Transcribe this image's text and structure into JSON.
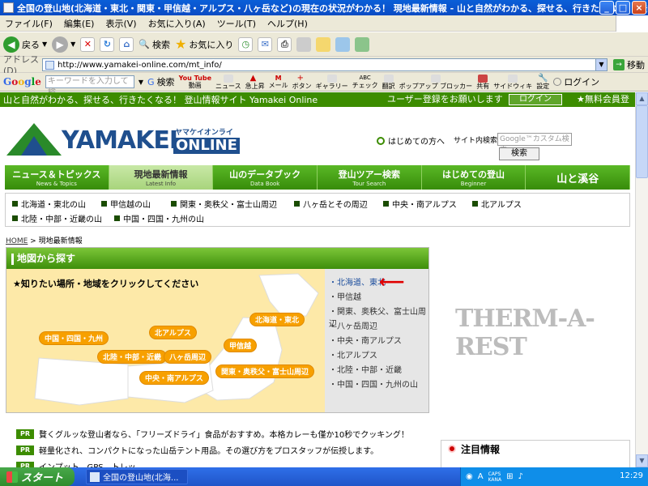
{
  "window": {
    "title": "全国の登山地(北海道・東北・関東・甲信越・アルプス・八ヶ岳など)の現在の状況がわかる！ 現地最新情報 - 山と自然がわかる、探せる、行きたくなる！ 登山情..."
  },
  "menu": [
    "ファイル(F)",
    "編集(E)",
    "表示(V)",
    "お気に入り(A)",
    "ツール(T)",
    "ヘルプ(H)"
  ],
  "toolbar": {
    "back": "戻る",
    "search": "検索",
    "favorites": "お気に入り"
  },
  "address": {
    "label": "アドレス(D)",
    "url": "http://www.yamakei-online.com/mt_info/",
    "go": "移動"
  },
  "google": {
    "logo": "Google",
    "placeholder": "キーワードを入力して検",
    "search_btn": "検索",
    "login": "ログイン",
    "tools": [
      "動画",
      "ニュース",
      "急上昇",
      "メール",
      "ボタン",
      "ギャラリー",
      "チェック",
      "翻訳",
      "ポップアップ ブロッカー",
      "共有",
      "サイドウィキ",
      "設定"
    ],
    "tool_tops": [
      "You Tube",
      "",
      "",
      "M",
      "",
      "",
      "ABC",
      "",
      "",
      "",
      "",
      ""
    ]
  },
  "site": {
    "tagline": "山と自然がわかる、探せる、行きたくなる！ 登山情報サイト Yamakei Online",
    "register": "ユーザー登録をお願いします",
    "login": "ログイン",
    "free": "★無料会員登録",
    "logo_main": "YAMAKEI",
    "logo_kana": "ヤマケイオンライン",
    "logo_online": "ONLINE",
    "first_time": "はじめての方へ",
    "site_search_label": "サイト内検索",
    "site_search_placeholder": "Google™カスタム検索",
    "site_search_btn": "検索"
  },
  "gnav": [
    {
      "label": "ニュース＆トピックス",
      "sub": "News & Topics"
    },
    {
      "label": "現地最新情報",
      "sub": "Latest Info"
    },
    {
      "label": "山のデータブック",
      "sub": "Data Book"
    },
    {
      "label": "登山ツアー検索",
      "sub": "Tour Search"
    },
    {
      "label": "はじめての登山",
      "sub": "Beginner"
    },
    {
      "label": "山と溪谷",
      "sub": ""
    }
  ],
  "areas": [
    "北海道・東北の山",
    "甲信越の山",
    "関東・奥秩父・富士山周辺",
    "八ヶ岳とその周辺",
    "中央・南アルプス",
    "北アルプス",
    "北陸・中部・近畿の山",
    "中国・四国・九州の山"
  ],
  "breadcrumb": {
    "home": "HOME",
    "current": "現地最新情報"
  },
  "map": {
    "header": "地図から探す",
    "prompt": "★知りたい場所・地域をクリックしてください",
    "pills": [
      "北海道・東北",
      "北アルプス",
      "甲信越",
      "中国・四国・九州",
      "北陸・中部・近畿",
      "八ヶ岳周辺",
      "中央・南アルプス",
      "関東・奥秩父・富士山周辺"
    ],
    "list": [
      "・北海道、東北",
      "・甲信越",
      "・関東、奥秩父、富士山周辺",
      "・八ヶ岳周辺",
      "・中央・南アルプス",
      "・北アルプス",
      "・北陸・中部・近畿",
      "・中国・四国・九州の山"
    ]
  },
  "ad": "THERM-A-REST",
  "pr": [
    {
      "tag": "PR",
      "text": "贅くグルッな登山者なら、「フリーズドライ」食品がおすすめ。本格カレーも僅か10秒でクッキング！"
    },
    {
      "tag": "PR",
      "text": "軽量化され、コンパクトになった山岳テント用品。その選び方をプロスタッフが伝授します。"
    },
    {
      "tag": "PR",
      "text": "インプット、GPS、トレッ..."
    }
  ],
  "notice": {
    "title": "注目情報"
  },
  "taskbar": {
    "start": "スタート",
    "item": "全国の登山地(北海...",
    "clock": "12:29",
    "tray_caps": "CAPS",
    "tray_kana": "KANA"
  }
}
